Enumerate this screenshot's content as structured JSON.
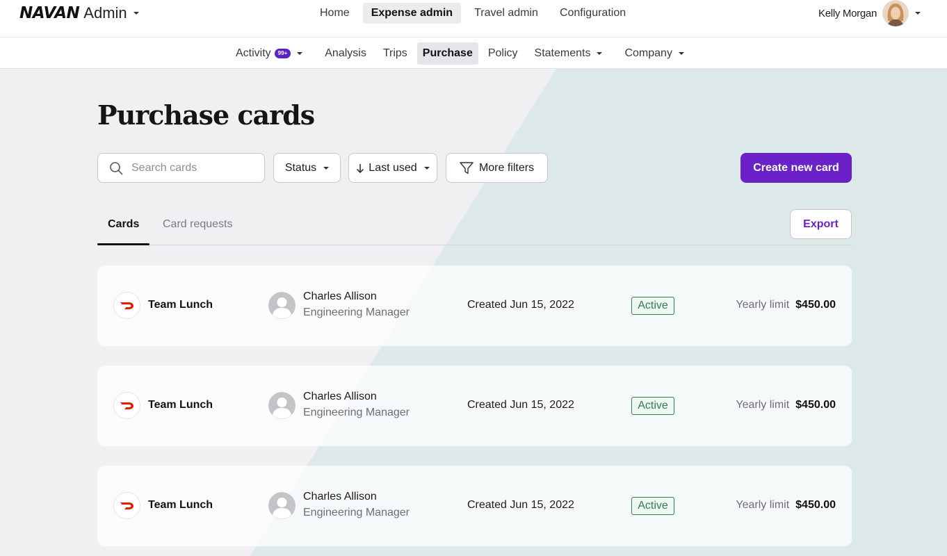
{
  "brand": {
    "logo": "NAVAN",
    "product": "Admin"
  },
  "topnav": [
    {
      "label": "Home",
      "active": false
    },
    {
      "label": "Expense admin",
      "active": true
    },
    {
      "label": "Travel admin",
      "active": false
    },
    {
      "label": "Configuration",
      "active": false
    }
  ],
  "user": {
    "name": "Kelly Morgan"
  },
  "subnav": {
    "activity": {
      "label": "Activity",
      "badge": "99+"
    },
    "analysis": "Analysis",
    "trips": "Trips",
    "purchase": "Purchase",
    "policy": "Policy",
    "statements": "Statements",
    "company": "Company"
  },
  "page": {
    "title": "Purchase cards"
  },
  "toolbar": {
    "search_placeholder": "Search cards",
    "status_label": "Status",
    "sort_label": "Last used",
    "filters_label": "More filters",
    "create_label": "Create new card"
  },
  "tabs": {
    "cards": "Cards",
    "requests": "Card requests",
    "export_label": "Export"
  },
  "colors": {
    "accent": "#6b21c8",
    "active_status": "#2f7d4f",
    "merchant": "#eb1700"
  },
  "cards": [
    {
      "merchant_icon": "doordash-logo-icon",
      "name": "Team Lunch",
      "holder": "Charles Allison",
      "role": "Engineering Manager",
      "created": "Created Jun 15, 2022",
      "status": "Active",
      "limit_label": "Yearly limit",
      "limit": "$450.00"
    },
    {
      "merchant_icon": "doordash-logo-icon",
      "name": "Team Lunch",
      "holder": "Charles Allison",
      "role": "Engineering Manager",
      "created": "Created Jun 15, 2022",
      "status": "Active",
      "limit_label": "Yearly limit",
      "limit": "$450.00"
    },
    {
      "merchant_icon": "doordash-logo-icon",
      "name": "Team Lunch",
      "holder": "Charles Allison",
      "role": "Engineering Manager",
      "created": "Created Jun 15, 2022",
      "status": "Active",
      "limit_label": "Yearly limit",
      "limit": "$450.00"
    }
  ]
}
